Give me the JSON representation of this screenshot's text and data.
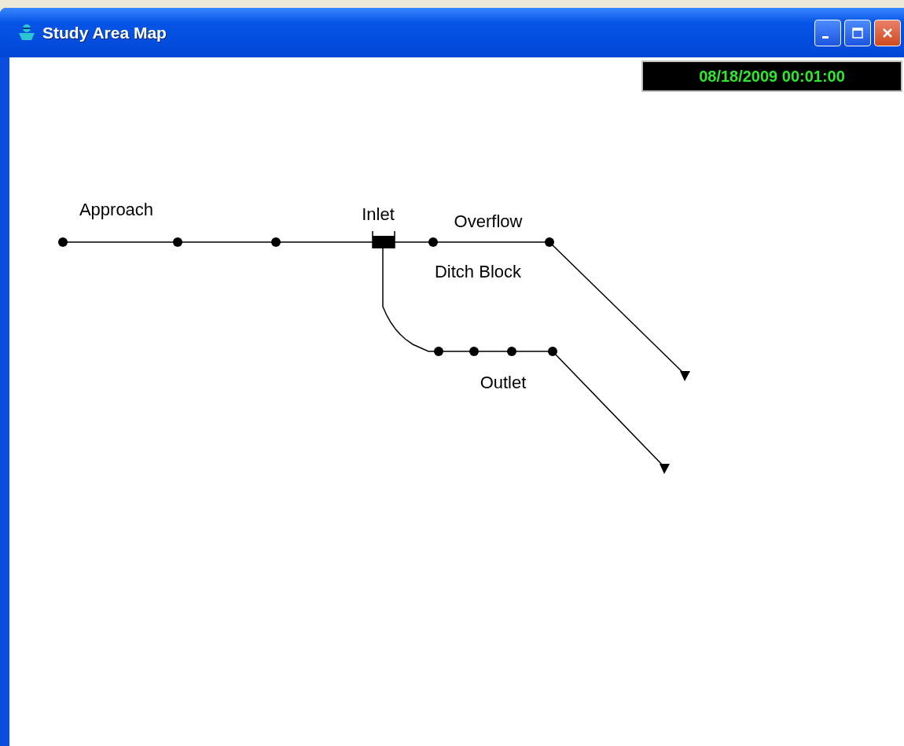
{
  "window": {
    "title": "Study Area Map"
  },
  "clock": {
    "text": "08/18/2009 00:01:00"
  },
  "map": {
    "labels": [
      "Approach",
      "Inlet",
      "Overflow",
      "Ditch Block",
      "Outlet"
    ]
  }
}
